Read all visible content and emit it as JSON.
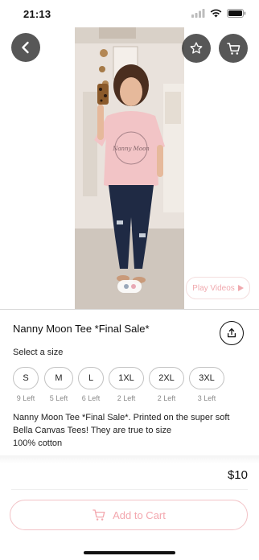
{
  "status_bar": {
    "time": "21:13"
  },
  "product": {
    "title": "Nanny Moon Tee *Final Sale*",
    "shirt_text": "Nanny Moon",
    "description_lines": [
      "Nanny Moon Tee *Final Sale*. Printed on the super soft",
      "Bella Canvas Tees! They are true to size",
      "100% cotton"
    ],
    "price": "$10"
  },
  "media": {
    "play_videos_label": "Play Videos",
    "carousel_dot_colors": [
      "#9aa8ba",
      "#e8a9b5"
    ]
  },
  "size_selector": {
    "label": "Select a size",
    "options": [
      {
        "size": "S",
        "stock": "9 Left"
      },
      {
        "size": "M",
        "stock": "5 Left"
      },
      {
        "size": "L",
        "stock": "6 Left"
      },
      {
        "size": "1XL",
        "stock": "2 Left"
      },
      {
        "size": "2XL",
        "stock": "2 Left"
      },
      {
        "size": "3XL",
        "stock": "3 Left"
      }
    ]
  },
  "actions": {
    "add_to_cart_label": "Add to Cart"
  },
  "icons": {
    "back": "back-arrow-icon",
    "favorite": "star-icon",
    "cart": "cart-icon",
    "share": "share-icon",
    "play": "play-triangle-icon"
  },
  "colors": {
    "accent_pink": "#f3a7ae",
    "button_border": "#f2c2c6"
  }
}
